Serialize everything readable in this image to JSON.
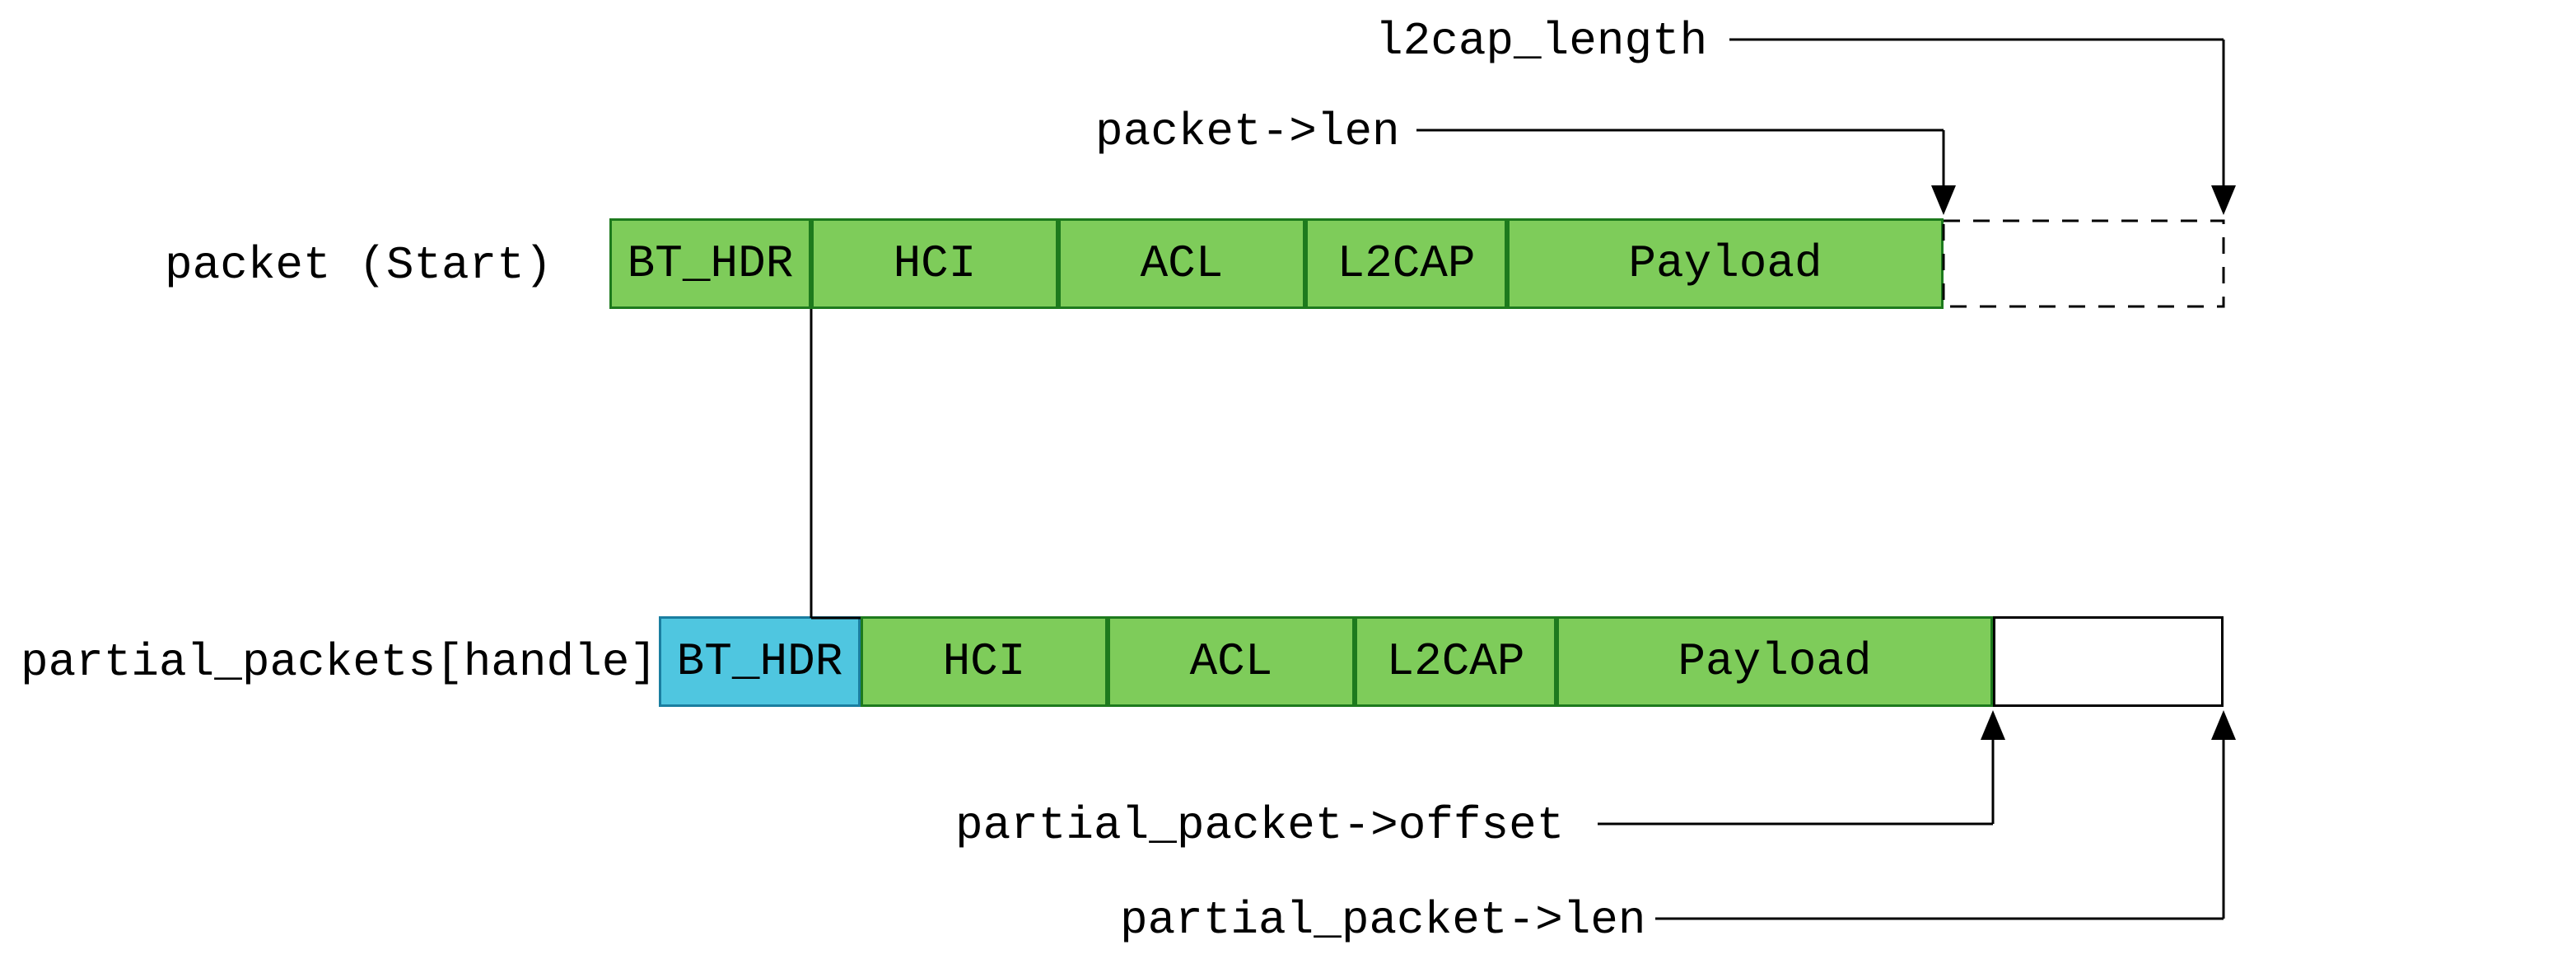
{
  "labels": {
    "l2cap_length": "l2cap_length",
    "packet_len": "packet->len",
    "packet_start": "packet (Start)",
    "partial_packets": "partial_packets[handle]",
    "partial_offset": "partial_packet->offset",
    "partial_len": "partial_packet->len"
  },
  "segments": {
    "bt_hdr": "BT_HDR",
    "hci": "HCI",
    "acl": "ACL",
    "l2cap": "L2CAP",
    "payload": "Payload"
  },
  "colors": {
    "green_fill": "#7ecc5a",
    "green_border": "#1d7a1d",
    "cyan_fill": "#4fc6e0",
    "cyan_border": "#1a7ea0"
  }
}
